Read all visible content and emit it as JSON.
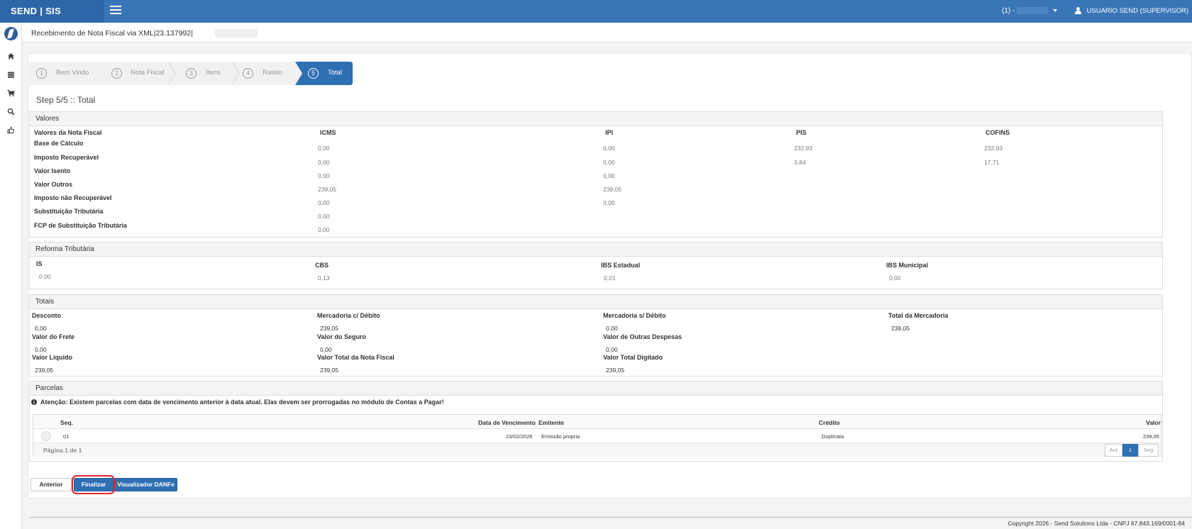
{
  "topbar": {
    "brand": "SEND | SIS",
    "company": "(1) -",
    "user": "USUARIO SEND (SUPERVISOR)",
    "brand_color": "#2d67a8",
    "bar_color": "#3a76b7"
  },
  "sidebar": {
    "icons": [
      "logo-icon",
      "home-icon",
      "server-icon",
      "cart-icon",
      "search-icon",
      "thumbs-up-icon"
    ]
  },
  "page": {
    "title": "Recebimento de Nota Fiscal via XML|23.137992|",
    "step_title": "Step 5/5 :: Total"
  },
  "wizard": {
    "steps": [
      {
        "num": "1",
        "label": "Bem Vindo"
      },
      {
        "num": "2",
        "label": "Nota Fiscal"
      },
      {
        "num": "3",
        "label": "Itens"
      },
      {
        "num": "4",
        "label": "Rateio"
      },
      {
        "num": "5",
        "label": "Total"
      }
    ],
    "active_color": "#2f6fb3"
  },
  "valores": {
    "title": "Valores",
    "col_headers": [
      "Valores da Nota Fiscal",
      "ICMS",
      "IPI",
      "PIS",
      "COFINS"
    ],
    "rows": [
      {
        "label": "Base de Cálculo",
        "icms": "0,00",
        "ipi": "0,00",
        "pis": "232,93",
        "cofins": "232,93"
      },
      {
        "label": "Imposto Recuperável",
        "icms": "0,00",
        "ipi": "0,00",
        "pis": "3,84",
        "cofins": "17,71"
      },
      {
        "label": "Valor Isento",
        "icms": "0,00",
        "ipi": "0,00",
        "pis": "",
        "cofins": ""
      },
      {
        "label": "Valor Outros",
        "icms": "239,05",
        "ipi": "239,05",
        "pis": "",
        "cofins": ""
      },
      {
        "label": "Imposto não Recuperável",
        "icms": "0,00",
        "ipi": "0,00",
        "pis": "",
        "cofins": ""
      },
      {
        "label": "Substituição Tributária",
        "icms": "0,00",
        "ipi": "",
        "pis": "",
        "cofins": ""
      },
      {
        "label": "FCP de Substituição Tributária",
        "icms": "0,00",
        "ipi": "",
        "pis": "",
        "cofins": ""
      }
    ]
  },
  "reforma": {
    "title": "Reforma Tributária",
    "items": [
      {
        "label": "IS",
        "value": "0,00"
      },
      {
        "label": "CBS",
        "value": "0,13"
      },
      {
        "label": "IBS Estadual",
        "value": "0,01"
      },
      {
        "label": "IBS Municipal",
        "value": "0,00"
      }
    ]
  },
  "totais": {
    "title": "Totais",
    "row1": [
      {
        "label": "Desconto",
        "value": "0,00"
      },
      {
        "label": "Mercadoria c/ Débito",
        "value": "239,05"
      },
      {
        "label": "Mercadoria s/ Débito",
        "value": "0,00"
      },
      {
        "label": "Total da Mercadoria",
        "value": "239,05"
      }
    ],
    "row2": [
      {
        "label": "Valor do Frete",
        "value": "0,00"
      },
      {
        "label": "Valor do Seguro",
        "value": "0,00"
      },
      {
        "label": "Valor de Outras Despesas",
        "value": "0,00"
      }
    ],
    "row3": [
      {
        "label": "Valor Líquido",
        "value": "239,05"
      },
      {
        "label": "Valor Total da Nota Fiscal",
        "value": "239,05"
      },
      {
        "label": "Valor Total Digitado",
        "value": "239,05"
      }
    ]
  },
  "parcelas": {
    "title": "Parcelas",
    "warning": "Atenção: Existem parcelas com data de vencimento anterior à data atual. Elas devem ser prorrogadas no módulo de Contas a Pagar!",
    "headers": {
      "seq": "Seq.",
      "vencimento": "Data de Vencimento",
      "emitente": "Emitente",
      "credito": "Crédito",
      "valor": "Valor"
    },
    "rows": [
      {
        "seq": "01",
        "vencimento": "23/02/2026",
        "emitente": "Emissão propria",
        "credito": "Duplicata",
        "valor": "239,05"
      }
    ],
    "page_info": "Página 1 de 1",
    "pager": {
      "prev": "Ant",
      "current": "1",
      "next": "Seg"
    }
  },
  "actions": {
    "anterior": "Anterior",
    "finalizar": "Finalizar",
    "danfe": "Visualizador DANFe"
  },
  "footer": "Copyright 2026 - Send Solutions Ltda - CNPJ 67.843.169/0001-84"
}
